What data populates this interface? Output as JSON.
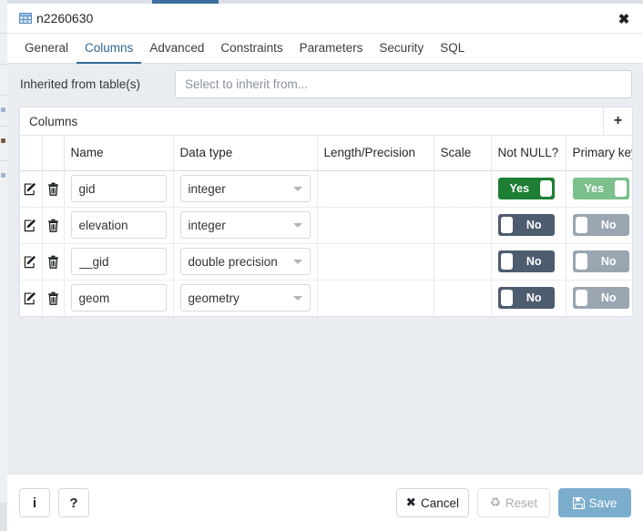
{
  "window": {
    "title": "n2260630",
    "title_icon": "table-icon",
    "close_icon": "close-icon"
  },
  "tabs": [
    {
      "label": "General",
      "active": false
    },
    {
      "label": "Columns",
      "active": true
    },
    {
      "label": "Advanced",
      "active": false
    },
    {
      "label": "Constraints",
      "active": false
    },
    {
      "label": "Parameters",
      "active": false
    },
    {
      "label": "Security",
      "active": false
    },
    {
      "label": "SQL",
      "active": false
    }
  ],
  "inherited": {
    "label": "Inherited from table(s)",
    "placeholder": "Select to inherit from...",
    "value": ""
  },
  "columns_panel": {
    "title": "Columns",
    "add_icon": "plus-icon",
    "add_label": "+",
    "headers": [
      "",
      "",
      "Name",
      "Data type",
      "Length/Precision",
      "Scale",
      "Not NULL?",
      "Primary key?"
    ],
    "rows": [
      {
        "edit_icon": "edit-pencil-icon",
        "delete_icon": "trash-icon",
        "name": "gid",
        "data_type": "integer",
        "length_precision": "",
        "scale": "",
        "not_null": "Yes",
        "not_null_state": "on",
        "primary_key": "Yes",
        "primary_key_state": "on",
        "primary_key_disabled": true
      },
      {
        "edit_icon": "edit-pencil-icon",
        "delete_icon": "trash-icon",
        "name": "elevation",
        "data_type": "integer",
        "length_precision": "",
        "scale": "",
        "not_null": "No",
        "not_null_state": "off",
        "primary_key": "No",
        "primary_key_state": "off",
        "primary_key_disabled": true
      },
      {
        "edit_icon": "edit-pencil-icon",
        "delete_icon": "trash-icon",
        "name": "__gid",
        "data_type": "double precision",
        "length_precision": "",
        "scale": "",
        "not_null": "No",
        "not_null_state": "off",
        "primary_key": "No",
        "primary_key_state": "off",
        "primary_key_disabled": true
      },
      {
        "edit_icon": "edit-pencil-icon",
        "delete_icon": "trash-icon",
        "name": "geom",
        "data_type": "geometry",
        "length_precision": "",
        "scale": "",
        "not_null": "No",
        "not_null_state": "off",
        "primary_key": "No",
        "primary_key_state": "off",
        "primary_key_disabled": true
      }
    ]
  },
  "footer": {
    "info_label": "i",
    "info_icon": "info-icon",
    "help_label": "?",
    "help_icon": "help-icon",
    "cancel_label": "Cancel",
    "cancel_icon": "x-icon",
    "reset_label": "Reset",
    "reset_icon": "refresh-icon",
    "save_label": "Save",
    "save_icon": "floppy-disk-icon"
  },
  "colors": {
    "accent": "#336a94",
    "toggle_on": "#1e7e34",
    "toggle_on_disabled": "#7cc08d",
    "toggle_off": "#4d5c6e",
    "toggle_off_disabled": "#9aa5b1",
    "save_button": "#7badcd",
    "body_bg": "#e9ecf0"
  }
}
